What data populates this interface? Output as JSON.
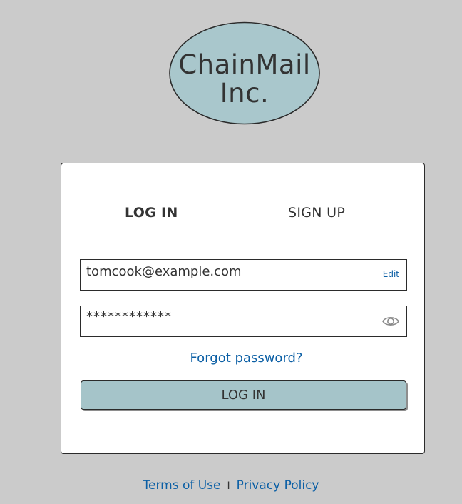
{
  "logo": {
    "line1": "ChainMail",
    "line2": "Inc.",
    "fill_color": "#a9c7cc"
  },
  "tabs": {
    "login_label": "LOG IN",
    "signup_label": "SIGN UP",
    "active": "LOG IN"
  },
  "form": {
    "email_value": "tomcook@example.com",
    "email_edit_label": "Edit",
    "password_value": "************",
    "password_toggle_icon": "eye-icon",
    "forgot_label": "Forgot password?",
    "submit_label": "LOG IN"
  },
  "footer": {
    "terms_label": "Terms of Use",
    "separator": "I",
    "privacy_label": "Privacy Policy"
  },
  "colors": {
    "background": "#cbcbcb",
    "button": "#a5c4c9",
    "link": "#0b5fa5"
  }
}
